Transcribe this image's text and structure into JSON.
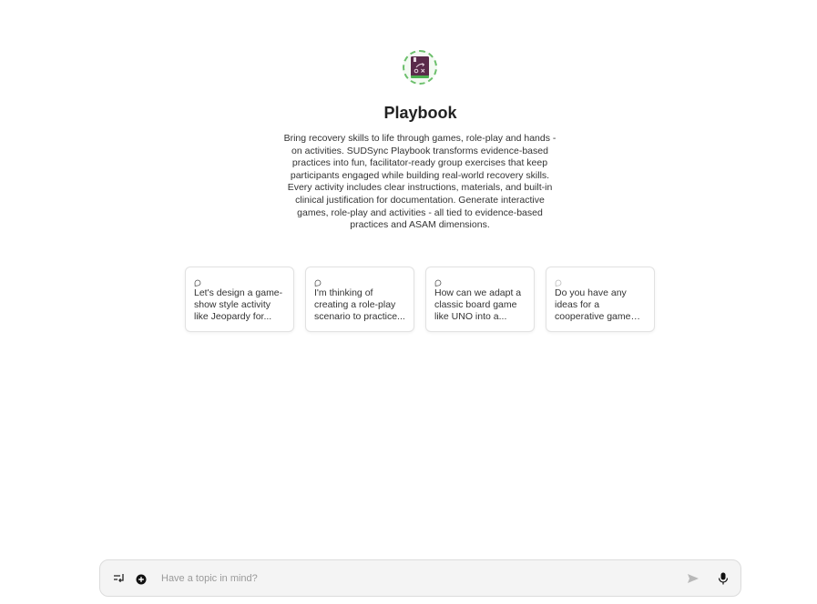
{
  "app": {
    "title": "Playbook",
    "description": "Bring recovery skills to life through games, role-play and hands - on activities. SUDSync Playbook transforms evidence-based practices into fun, facilitator-ready group exercises that keep participants engaged while building real-world recovery skills. Every activity includes clear instructions, materials, and built-in clinical justification for documentation. Generate interactive games, role-play and activities - all tied to evidence-based practices and ASAM dimensions."
  },
  "suggestions": [
    {
      "text": "Let's design a game-show style activity like Jeopardy for...",
      "icon": "chat-bubble-icon"
    },
    {
      "text": "I'm thinking of creating a role-play scenario to practice...",
      "icon": "chat-bubble-icon"
    },
    {
      "text": "How can we adapt a classic board game like UNO into a...",
      "icon": "chat-bubble-icon"
    },
    {
      "text": "Do you have any ideas for a cooperative game that can...",
      "icon": "chat-bubble-icon"
    }
  ],
  "composer": {
    "placeholder": "Have a topic in mind?",
    "value": "",
    "left_tools": [
      "enter-mode-icon",
      "plus-circle-icon"
    ],
    "right_tools": [
      "send-icon",
      "microphone-icon"
    ]
  },
  "colors": {
    "logo_book": "#5a2a4a",
    "logo_ring": "#6bbf6b",
    "logo_accent": "#4caf50"
  }
}
